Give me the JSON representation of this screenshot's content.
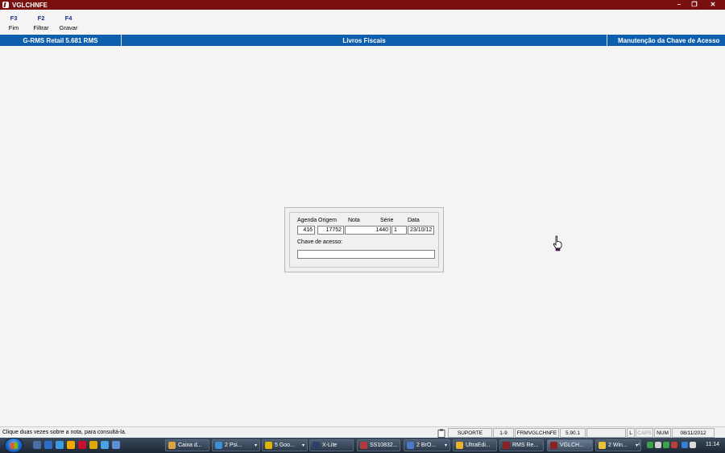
{
  "window": {
    "title": "VGLCHNFE"
  },
  "fkeys": [
    {
      "key": "F3",
      "label": "Fim"
    },
    {
      "key": "F2",
      "label": "Filtrar"
    },
    {
      "key": "F4",
      "label": "Gravar"
    }
  ],
  "header": {
    "left": "G-RMS Retail 5.681 RMS",
    "center": "Livros Fiscais",
    "right": "Manutenção da Chave de Acesso"
  },
  "form": {
    "labels": {
      "agenda": "Agenda",
      "origem": "Origem",
      "nota": "Nota",
      "serie": "Série",
      "data": "Data",
      "chave": "Chave de acesso:"
    },
    "values": {
      "agenda": "416",
      "origem": "17752",
      "nota": "1440",
      "serie": "1",
      "data": "23/10/12",
      "chave": ""
    }
  },
  "status": {
    "message": "Clique duas vezes sobre a nota, para consultá-la.",
    "user": "SUPORTE",
    "range": "1-9",
    "form": "FRMVGLCHNFE",
    "version": "5.90.1",
    "l": "L",
    "caps": "CAPS",
    "num": "NUM",
    "date": "08/11/2012"
  },
  "taskbar": {
    "items": [
      {
        "label": "Caixa d...",
        "icon_color": "#d9a441"
      },
      {
        "label": "2 Psi...",
        "icon_color": "#3a8fd6"
      },
      {
        "label": "5 Goo...",
        "icon_color": "#e0b400"
      },
      {
        "label": "X-Lite",
        "icon_color": "#2b3f6a"
      },
      {
        "label": "SS10832...",
        "icon_color": "#b33a3a"
      },
      {
        "label": "2 BrO...",
        "icon_color": "#4a79c9"
      },
      {
        "label": "UltraEdi...",
        "icon_color": "#e8b22a"
      },
      {
        "label": "RMS Re...",
        "icon_color": "#8a2222"
      },
      {
        "label": "VGLCH...",
        "icon_color": "#8a2222"
      },
      {
        "label": "2 Win...",
        "icon_color": "#e8c23a"
      }
    ],
    "clock": "11:14"
  },
  "colors": {
    "title_bar": "#7a0f0f",
    "header_blue": "#0d5fae",
    "fkey_blue": "#1a2d8f"
  }
}
